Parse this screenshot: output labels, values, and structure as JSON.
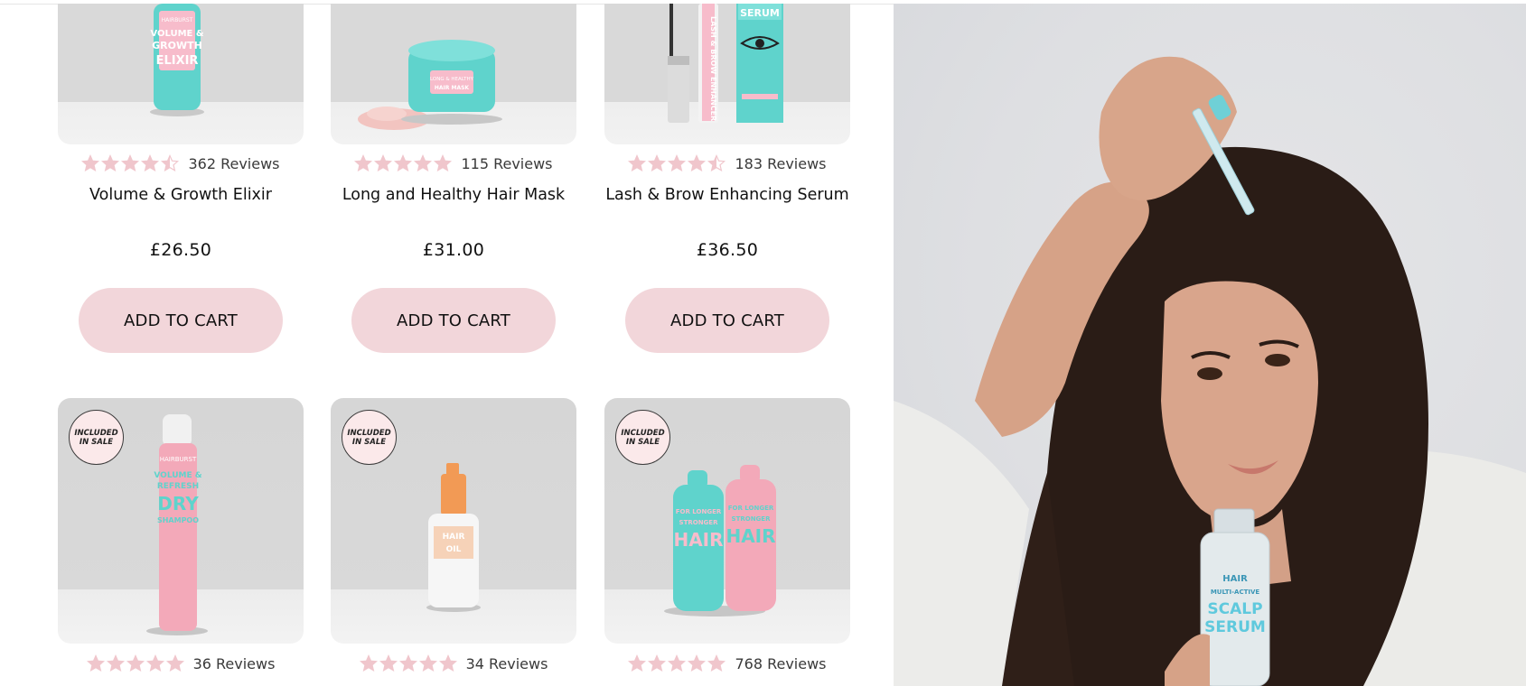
{
  "products": [
    {
      "name": "Volume & Growth Elixir",
      "rating": 4.5,
      "reviews": "362 Reviews",
      "price": "£26.50",
      "cta": "ADD TO CART"
    },
    {
      "name": "Long and Healthy Hair Mask",
      "rating": 5,
      "reviews": "115 Reviews",
      "price": "£31.00",
      "cta": "ADD TO CART"
    },
    {
      "name": "Lash & Brow Enhancing Serum",
      "rating": 4.5,
      "reviews": "183 Reviews",
      "price": "£36.50",
      "cta": "ADD TO CART"
    },
    {
      "badge_line1": "INCLUDED",
      "badge_line2": "IN SALE",
      "rating": 5,
      "reviews": "36 Reviews"
    },
    {
      "badge_line1": "INCLUDED",
      "badge_line2": "IN SALE",
      "rating": 5,
      "reviews": "34 Reviews"
    },
    {
      "badge_line1": "INCLUDED",
      "badge_line2": "IN SALE",
      "rating": 5,
      "reviews": "768 Reviews"
    }
  ],
  "packaging": {
    "brand": "HAIRBURST",
    "elixir": [
      "VOLUME &",
      "GROWTH",
      "ELIXIR"
    ],
    "mask": [
      "LONG & HEALTHY",
      "HAIR MASK"
    ],
    "lash_box": "SERUM",
    "lash_tube": "LASH & BROW ENHANCER",
    "dry_shampoo": [
      "VOLUME &",
      "REFRESH",
      "DRY",
      "SHAMPOO"
    ],
    "hair_oil": [
      "HAIR",
      "OIL"
    ],
    "duo": [
      "FOR LONGER",
      "STRONGER",
      "HAIR"
    ],
    "hero_bottle": [
      "HAIR",
      "MULTI-ACTIVE",
      "SCALP",
      "SERUM"
    ]
  },
  "colors": {
    "star": "#f0c6cc",
    "button": "#f2d6da",
    "teal": "#5fd3cc",
    "pink": "#f2a7b9"
  }
}
